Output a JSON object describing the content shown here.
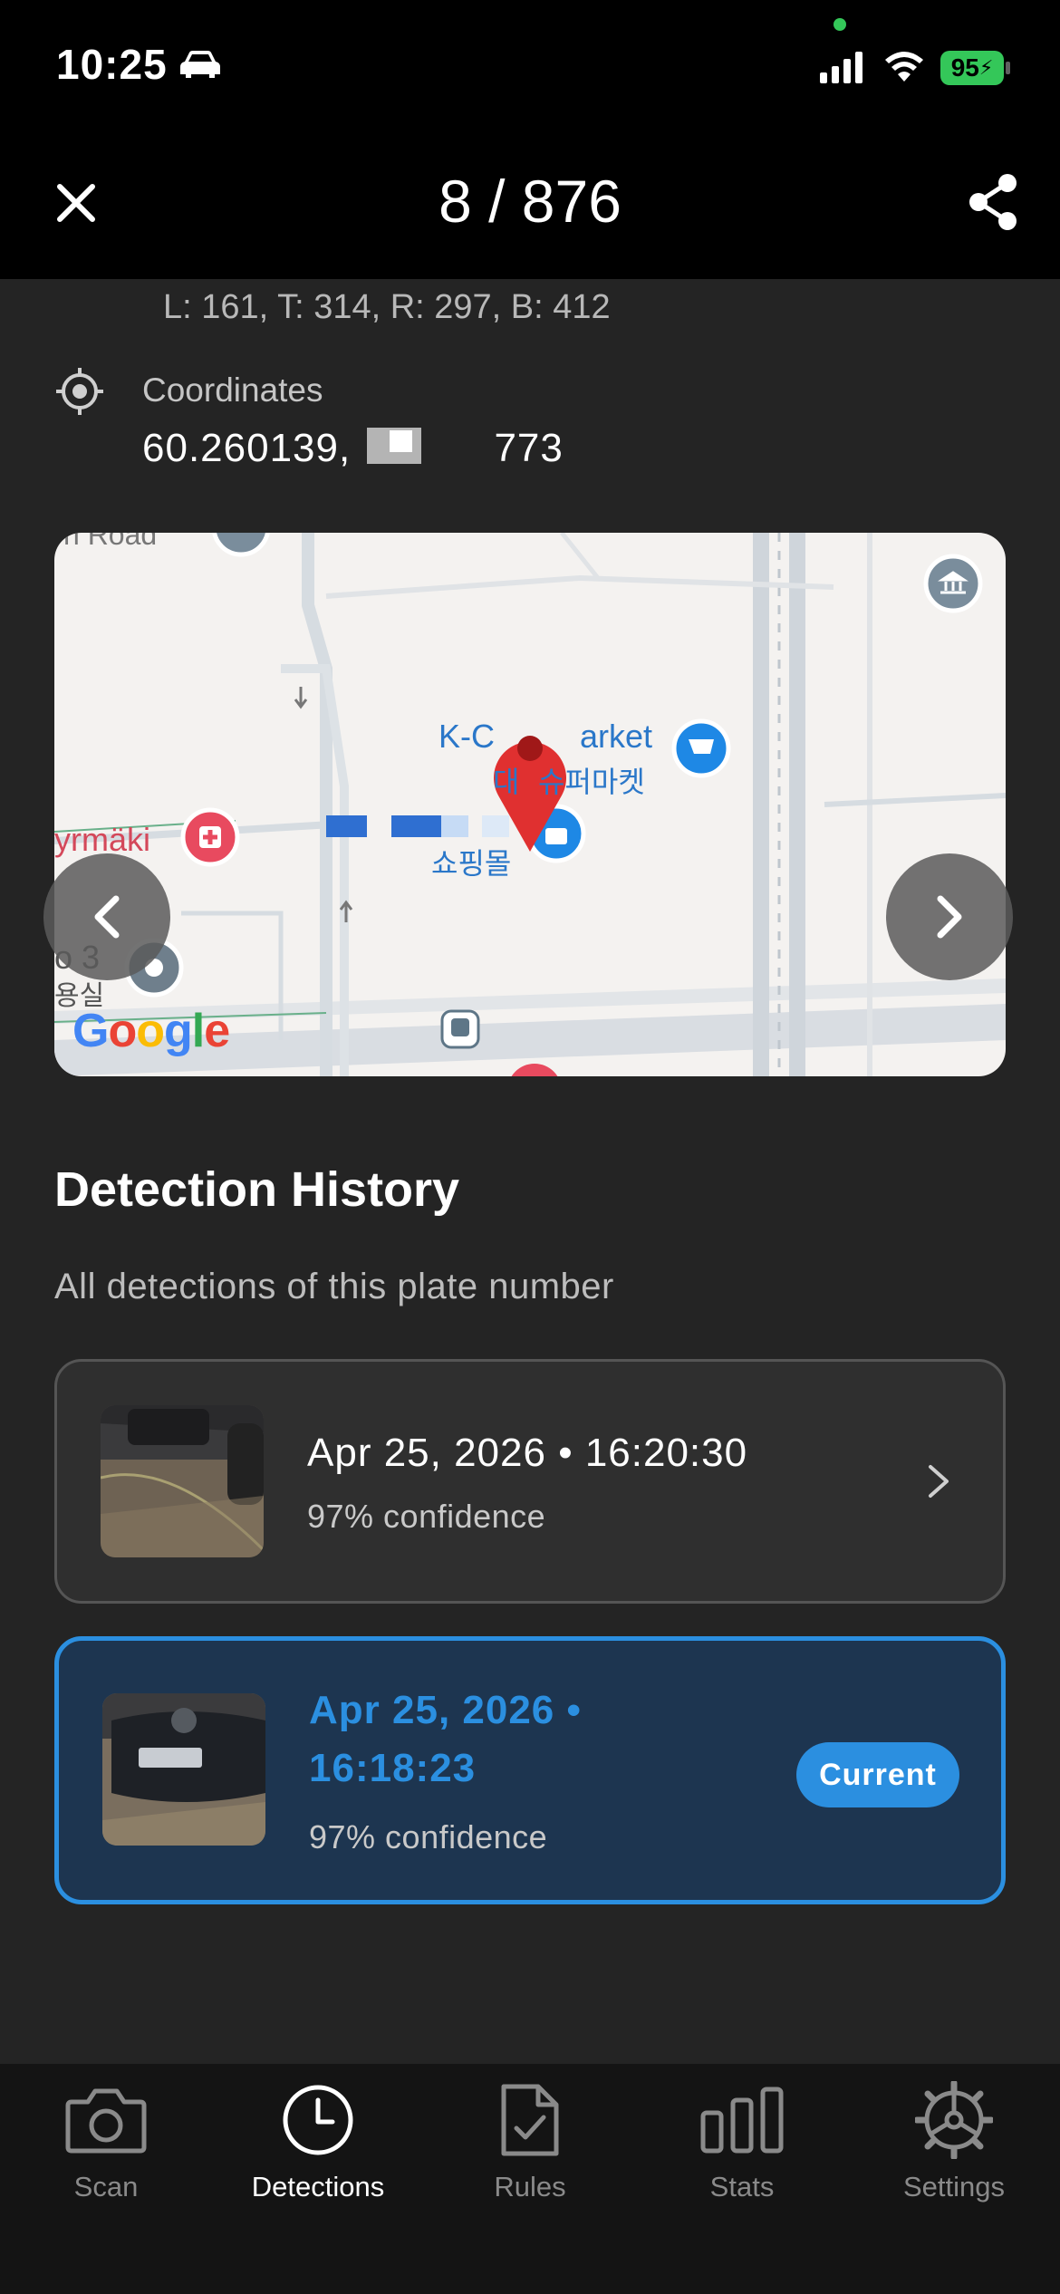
{
  "status_bar": {
    "time": "10:25",
    "battery": "95"
  },
  "header": {
    "counter": "8 / 876"
  },
  "detail": {
    "bbox": "L: 161, T: 314, R: 297, B: 412",
    "coordinates_label": "Coordinates",
    "coordinates_start": "60.260139, ",
    "coordinates_end": "773"
  },
  "map": {
    "labels": {
      "market": "K-C",
      "market2": "arket",
      "korean_market_a": "대",
      "korean_market_b": " 슈퍼마켓",
      "shopping": "쇼핑몰",
      "road_left": "yrmäki",
      "road_top": "n Road",
      "place_left": "o 3",
      "place_left_kr": "용실"
    },
    "google": [
      "G",
      "o",
      "o",
      "g",
      "l",
      "e"
    ]
  },
  "history": {
    "title": "Detection History",
    "subtitle": "All detections of this plate number",
    "items": [
      {
        "date": "Apr 25, 2026 • 16:20:30",
        "confidence": "97% confidence"
      },
      {
        "date_line1": "Apr 25, 2026 •",
        "date_line2": "16:18:23",
        "confidence": "97% confidence",
        "badge": "Current"
      }
    ]
  },
  "tabs": [
    {
      "label": "Scan",
      "icon": "camera-icon"
    },
    {
      "label": "Detections",
      "icon": "clock-icon",
      "active": true
    },
    {
      "label": "Rules",
      "icon": "document-check-icon"
    },
    {
      "label": "Stats",
      "icon": "bar-chart-icon"
    },
    {
      "label": "Settings",
      "icon": "gear-icon"
    }
  ],
  "colors": {
    "accent": "#2b8fe0",
    "background": "#242424",
    "card": "#2f2f2f",
    "current_card": "#1d3550"
  }
}
